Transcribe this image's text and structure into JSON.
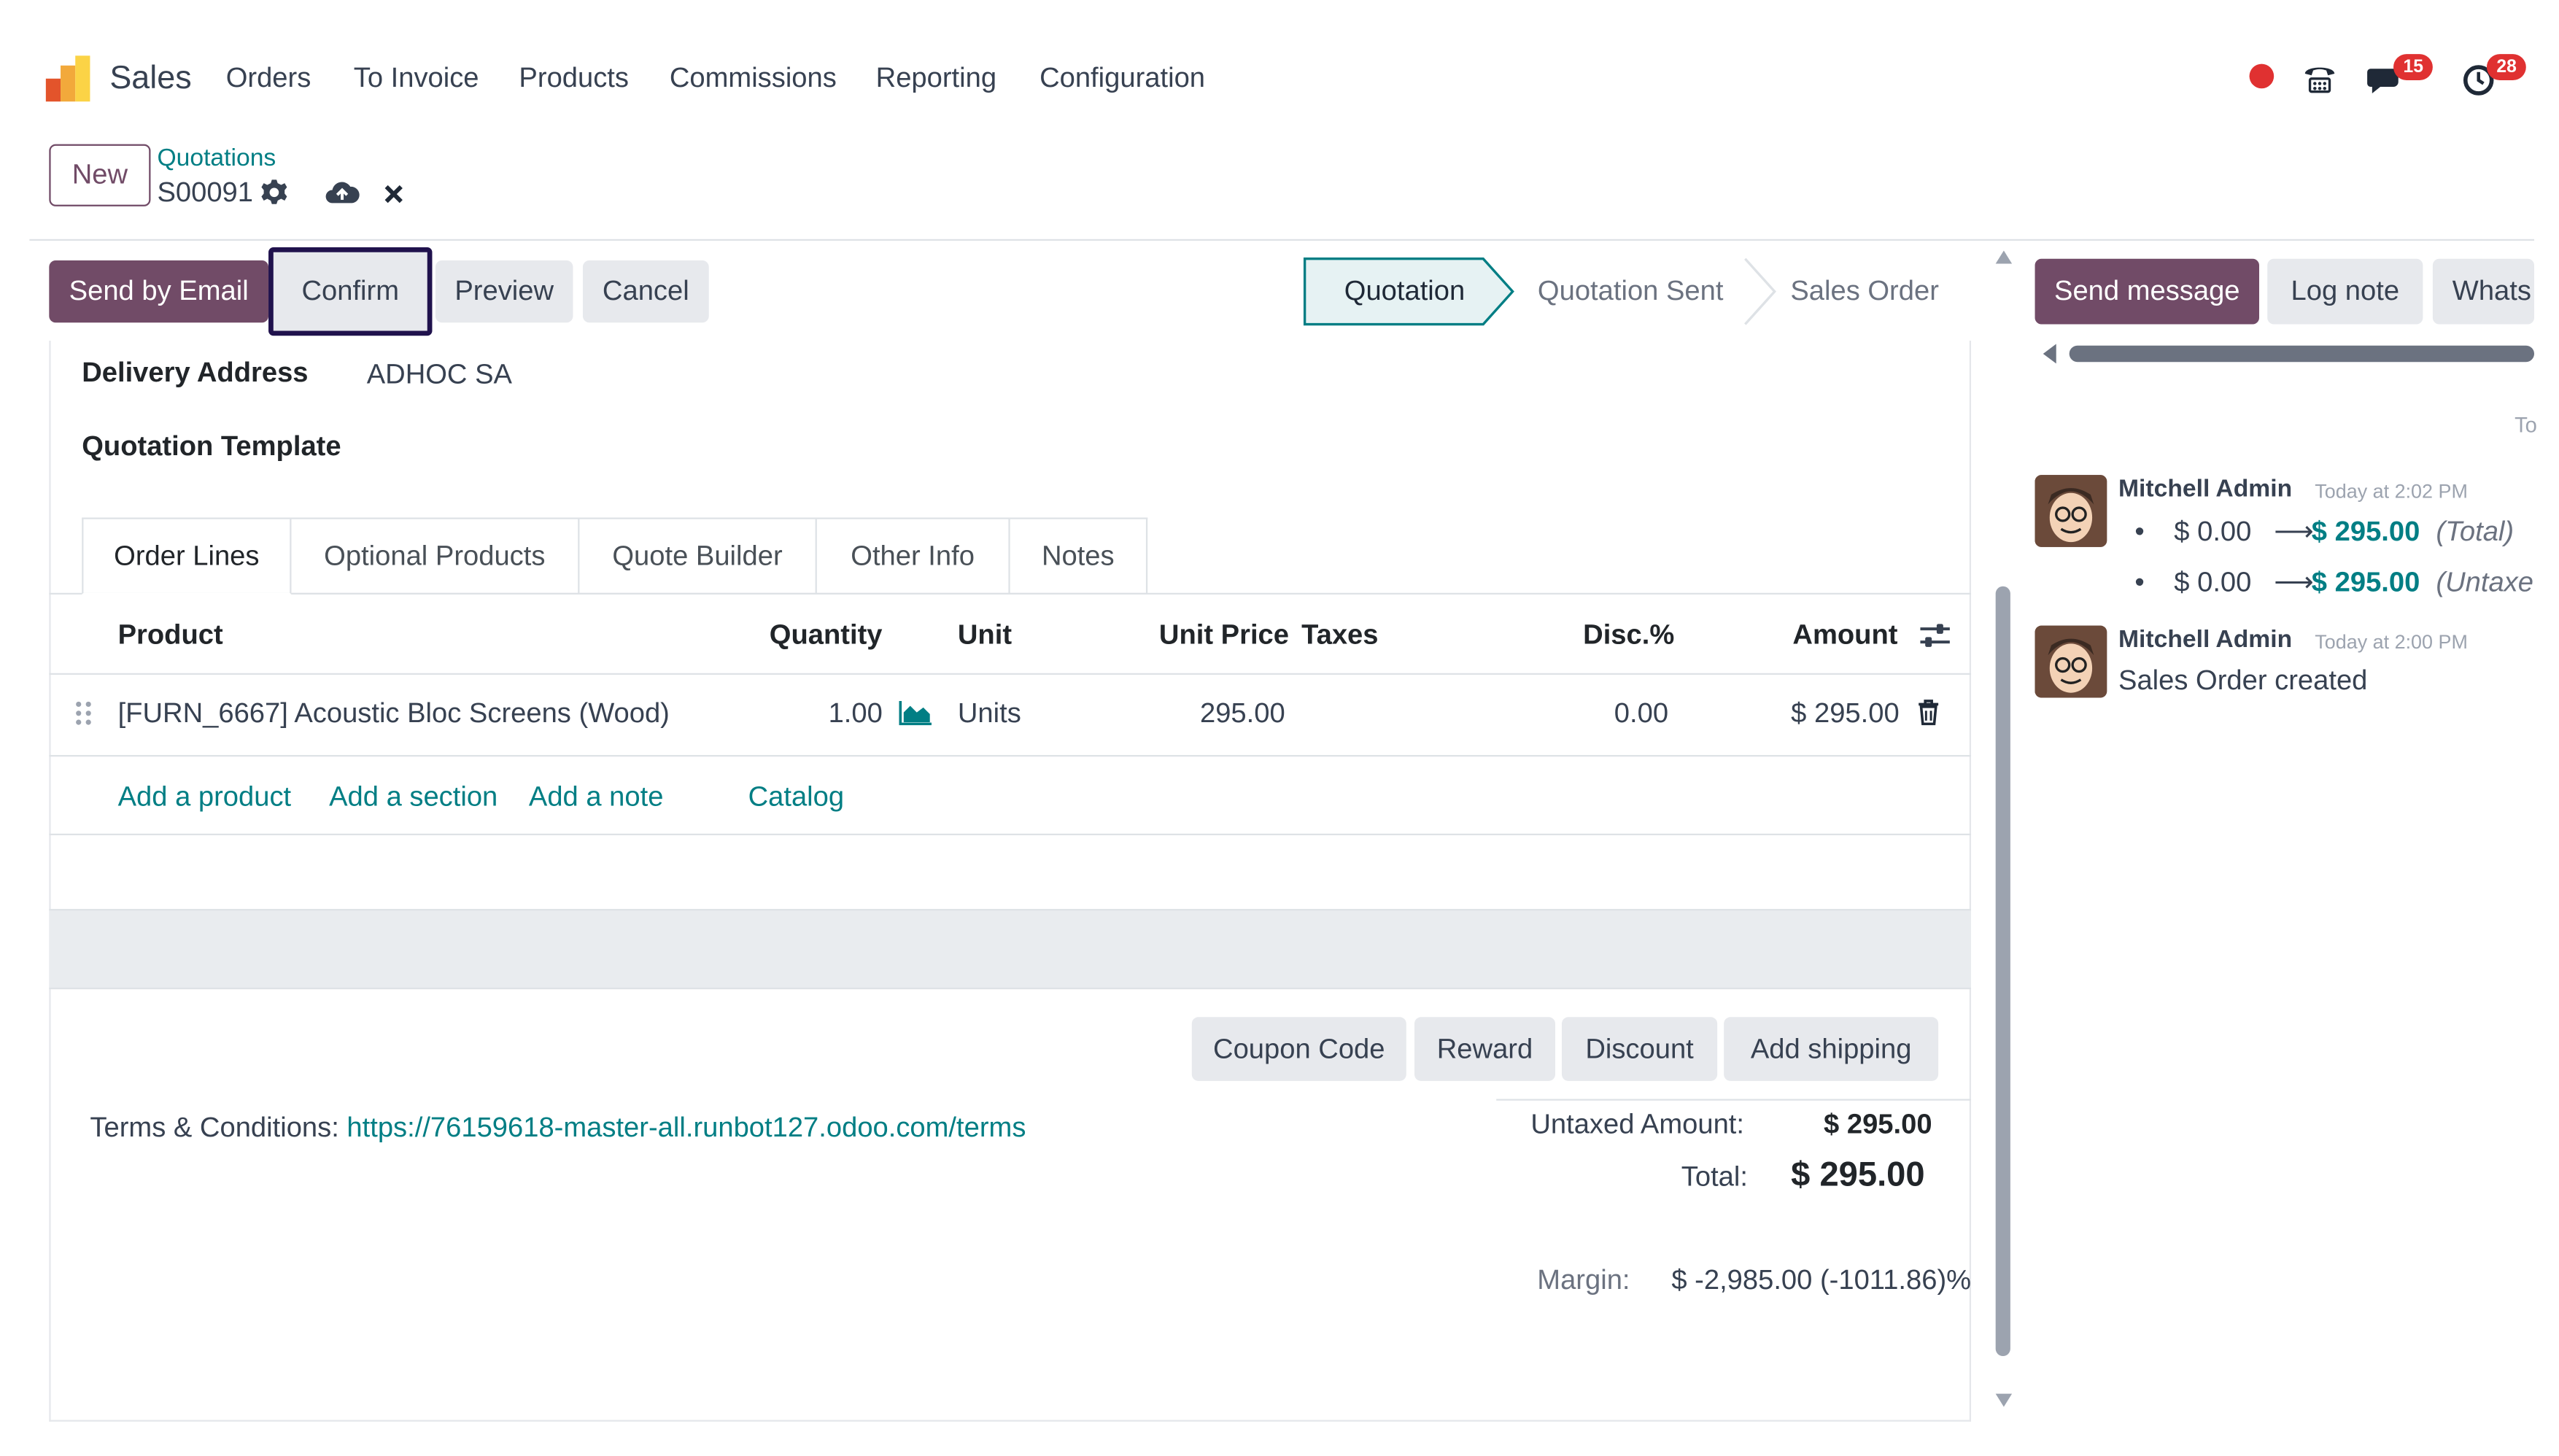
{
  "app": {
    "name": "Sales"
  },
  "nav": [
    "Orders",
    "To Invoice",
    "Products",
    "Commissions",
    "Reporting",
    "Configuration"
  ],
  "systray": {
    "messages_count": "15",
    "activities_count": "28"
  },
  "breadcrumb": {
    "new_label": "New",
    "parent": "Quotations",
    "record": "S00091"
  },
  "actions": {
    "send_email": "Send by Email",
    "confirm": "Confirm",
    "preview": "Preview",
    "cancel": "Cancel"
  },
  "statusbar": [
    "Quotation",
    "Quotation Sent",
    "Sales Order"
  ],
  "fields": {
    "delivery_label": "Delivery Address",
    "delivery_value": "ADHOC SA",
    "template_label": "Quotation Template"
  },
  "tabs": [
    "Order Lines",
    "Optional Products",
    "Quote Builder",
    "Other Info",
    "Notes"
  ],
  "table": {
    "headers": {
      "product": "Product",
      "quantity": "Quantity",
      "unit": "Unit",
      "unit_price": "Unit Price",
      "taxes": "Taxes",
      "disc": "Disc.%",
      "amount": "Amount"
    },
    "rows": [
      {
        "product": "[FURN_6667] Acoustic Bloc Screens (Wood)",
        "quantity": "1.00",
        "unit": "Units",
        "unit_price": "295.00",
        "disc": "0.00",
        "amount": "$ 295.00"
      }
    ],
    "add_product": "Add a product",
    "add_section": "Add a section",
    "add_note": "Add a note",
    "catalog": "Catalog"
  },
  "extra_buttons": [
    "Coupon Code",
    "Reward",
    "Discount",
    "Add shipping"
  ],
  "terms": {
    "label": "Terms & Conditions: ",
    "url": "https://76159618-master-all.runbot127.odoo.com/terms"
  },
  "totals": {
    "untaxed_label": "Untaxed Amount:",
    "untaxed_value": "$ 295.00",
    "total_label": "Total:",
    "total_value": "$ 295.00",
    "margin_label": "Margin:",
    "margin_value": "$ -2,985.00 (-1011.86)%"
  },
  "chatter": {
    "send_message": "Send message",
    "log_note": "Log note",
    "whatsapp": "Whats",
    "date_sep": "To",
    "messages": [
      {
        "author": "Mitchell Admin",
        "time": "Today at 2:02 PM",
        "changes": [
          {
            "old": "$ 0.00",
            "new": "$ 295.00",
            "field": "(Total)"
          },
          {
            "old": "$ 0.00",
            "new": "$ 295.00",
            "field": "(Untaxed"
          }
        ]
      },
      {
        "author": "Mitchell Admin",
        "time": "Today at 2:00 PM",
        "body": "Sales Order created"
      }
    ]
  },
  "colors": {
    "primary": "#714b67",
    "link": "#017e84",
    "highlight_border": "#20124d",
    "badge": "#e03131"
  }
}
